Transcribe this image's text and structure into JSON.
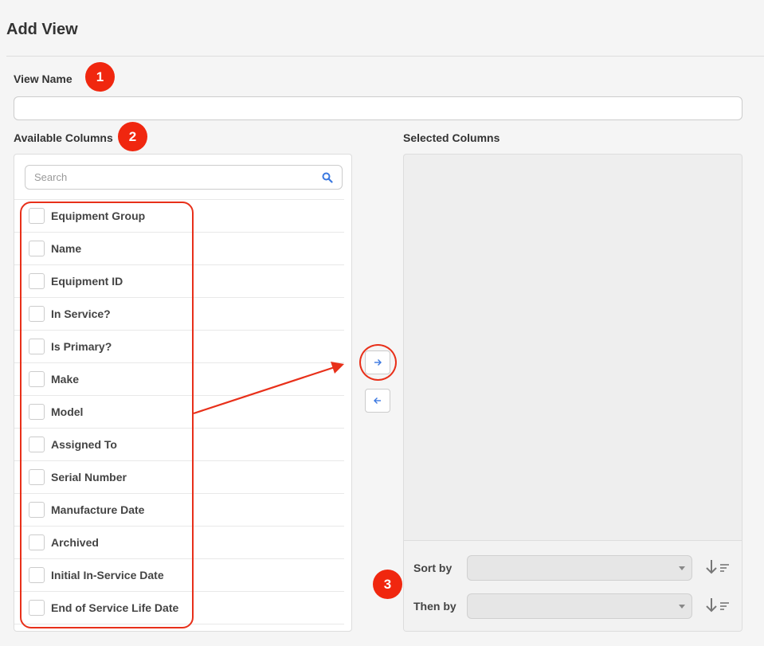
{
  "page": {
    "title": "Add View"
  },
  "view_name": {
    "label": "View Name",
    "value": ""
  },
  "available": {
    "label": "Available Columns",
    "search_placeholder": "Search",
    "items": [
      "Equipment Group",
      "Name",
      "Equipment ID",
      "In Service?",
      "Is Primary?",
      "Make",
      "Model",
      "Assigned To",
      "Serial Number",
      "Manufacture Date",
      "Archived",
      "Initial In-Service Date",
      "End of Service Life Date"
    ]
  },
  "transfer": {
    "add_icon": "arrow-right-icon",
    "remove_icon": "arrow-left-icon"
  },
  "selected": {
    "label": "Selected Columns",
    "sort_by_label": "Sort by",
    "sort_by_value": "",
    "then_by_label": "Then by",
    "then_by_value": ""
  },
  "annotations": {
    "badge1": "1",
    "badge2": "2",
    "badge3": "3"
  },
  "colors": {
    "annotation_red": "#f0270f",
    "accent_blue": "#3a78e0"
  }
}
